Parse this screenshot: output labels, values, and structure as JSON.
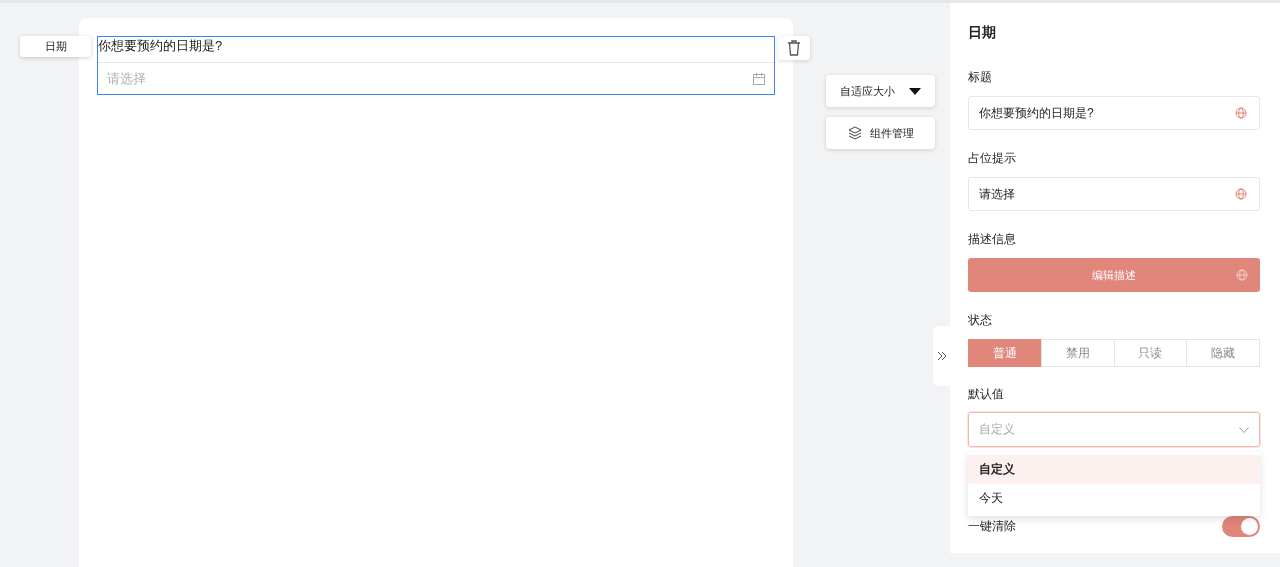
{
  "canvas": {
    "field": {
      "tag": "日期",
      "label": "你想要预约的日期是?",
      "placeholder": "请选择",
      "selected": true
    }
  },
  "toolbar": {
    "size_button": "自适应大小",
    "components_button": "组件管理"
  },
  "panel": {
    "title": "日期",
    "fields": [
      {
        "label": "标题",
        "value": "你想要预约的日期是?"
      },
      {
        "label": "占位提示",
        "value": "请选择"
      }
    ],
    "description": {
      "label": "描述信息",
      "button": "编辑描述"
    },
    "status": {
      "label": "状态",
      "options": [
        {
          "label": "普通",
          "selected": true
        },
        {
          "label": "禁用",
          "selected": false
        },
        {
          "label": "只读",
          "selected": false
        },
        {
          "label": "隐藏",
          "selected": false
        }
      ]
    },
    "default_value": {
      "label": "默认值",
      "value": "自定义",
      "expanded": true,
      "options": [
        {
          "label": "自定义",
          "selected": true
        },
        {
          "label": "今天",
          "selected": false
        }
      ]
    },
    "clear": {
      "label": "一键清除",
      "on": true
    }
  }
}
